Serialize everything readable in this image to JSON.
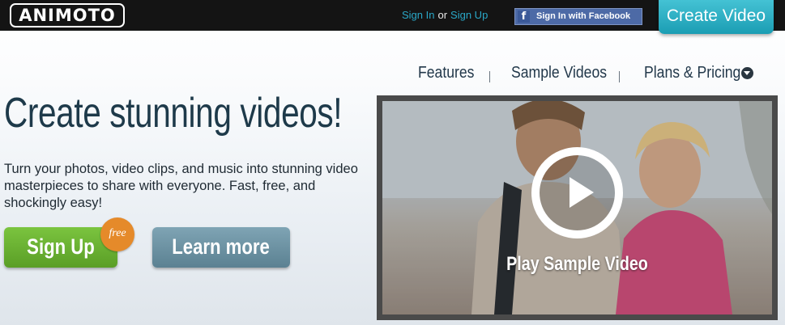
{
  "header": {
    "logo_text": "ANIMOTO",
    "sign_in": "Sign In",
    "or": "or",
    "sign_up": "Sign Up",
    "facebook_label": "Sign In with Facebook",
    "create_video": "Create Video"
  },
  "nav": {
    "items": [
      {
        "label": "Features"
      },
      {
        "label": "Sample Videos"
      },
      {
        "label": "Plans & Pricing"
      }
    ]
  },
  "hero": {
    "headline": "Create stunning videos!",
    "subtext": "Turn your photos, video clips, and music into stunning video masterpieces to share with everyone. Fast, free, and shockingly easy!",
    "signup_label": "Sign Up",
    "free_badge": "free",
    "learn_more_label": "Learn more"
  },
  "video": {
    "play_label": "Play Sample Video"
  },
  "icons": {
    "facebook": "facebook-icon",
    "dropdown": "chevron-down-icon",
    "play": "play-icon"
  },
  "colors": {
    "accent_teal": "#1b9db3",
    "link_blue": "#2aa8c8",
    "signup_green": "#5a9e26",
    "free_orange": "#e58a2a",
    "heading_navy": "#1e3a4a"
  }
}
